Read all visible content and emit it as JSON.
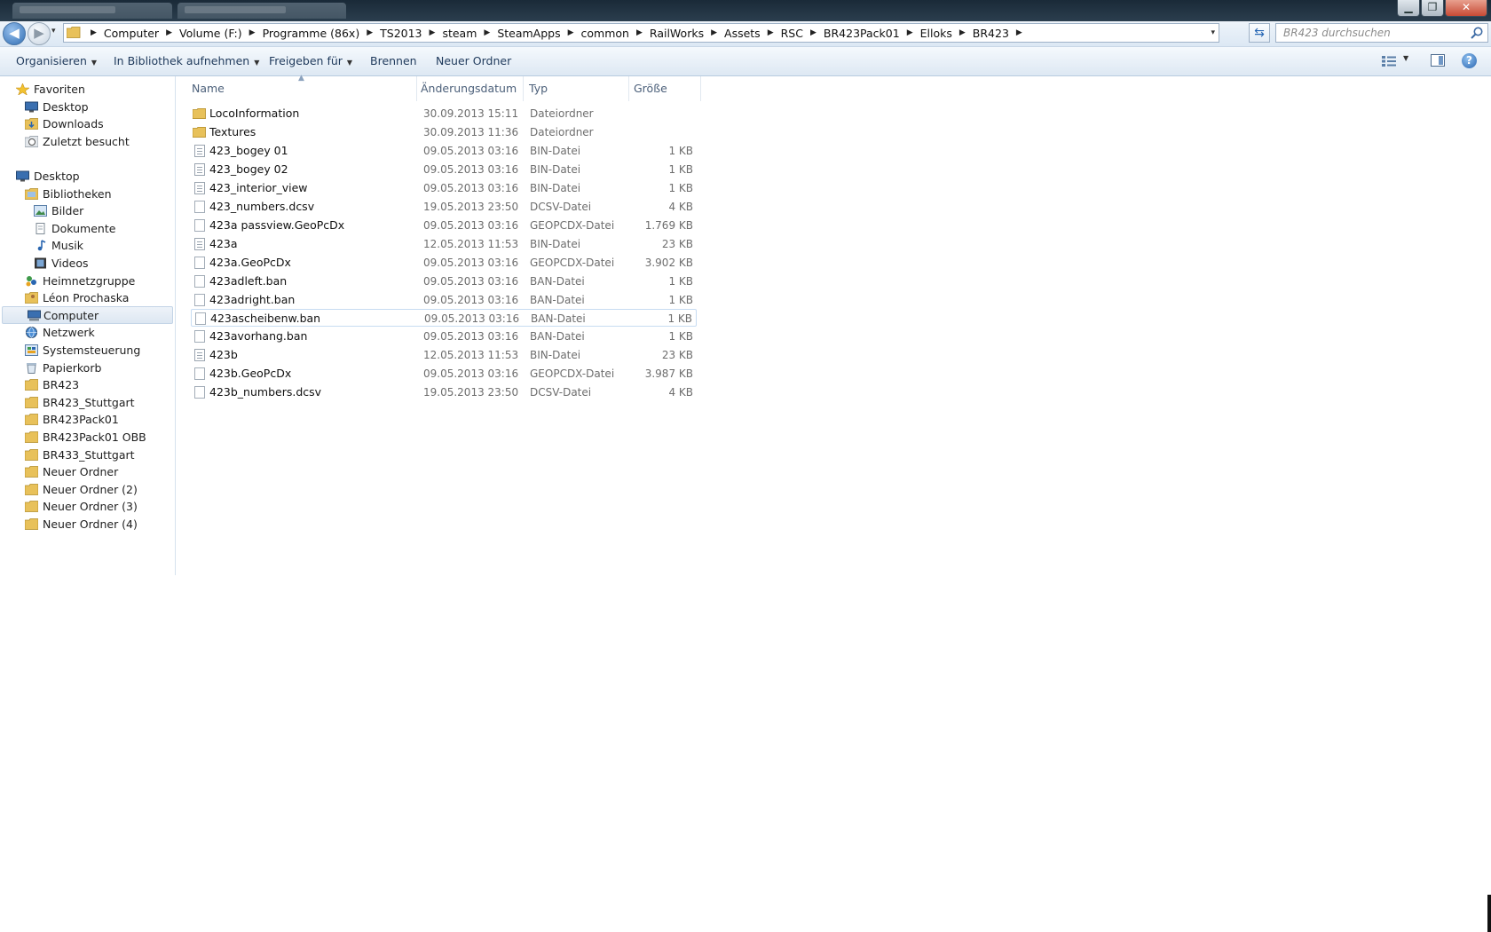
{
  "window": {
    "minimize": "▁",
    "maximize": "❐",
    "close": "✕"
  },
  "navigation": {
    "back": "◀",
    "forward": "▶",
    "dropdown": "▾"
  },
  "address": {
    "breadcrumb": [
      "Computer",
      "Volume (F:)",
      "Programme (86x)",
      "TS2013",
      "steam",
      "SteamApps",
      "common",
      "RailWorks",
      "Assets",
      "RSC",
      "BR423Pack01",
      "Elloks",
      "BR423"
    ],
    "separator": "▶"
  },
  "search": {
    "placeholder": "BR423 durchsuchen"
  },
  "toolbar": {
    "organize": "Organisieren",
    "add_to_library": "In Bibliothek aufnehmen",
    "share_with": "Freigeben für",
    "burn": "Brennen",
    "new_folder": "Neuer Ordner",
    "help": "?"
  },
  "sidebar": {
    "favorites": {
      "label": "Favoriten",
      "items": [
        "Desktop",
        "Downloads",
        "Zuletzt besucht"
      ]
    },
    "desktop": "Desktop",
    "libraries": {
      "label": "Bibliotheken",
      "items": [
        "Bilder",
        "Dokumente",
        "Musik",
        "Videos"
      ]
    },
    "items": [
      "Heimnetzgruppe",
      "Léon Prochaska",
      "Computer",
      "Netzwerk",
      "Systemsteuerung",
      "Papierkorb",
      "BR423",
      "BR423_Stuttgart",
      "BR423Pack01",
      "BR423Pack01 OBB",
      "BR433_Stuttgart",
      "Neuer Ordner",
      "Neuer Ordner (2)",
      "Neuer Ordner (3)",
      "Neuer Ordner (4)"
    ],
    "selected": "Computer"
  },
  "columns": {
    "name": "Name",
    "date": "Änderungsdatum",
    "type": "Typ",
    "size": "Größe"
  },
  "files": [
    {
      "name": "LocoInformation",
      "date": "30.09.2013 15:11",
      "type": "Dateiordner",
      "size": "",
      "icon": "folder"
    },
    {
      "name": "Textures",
      "date": "30.09.2013 11:36",
      "type": "Dateiordner",
      "size": "",
      "icon": "folder"
    },
    {
      "name": "423_bogey 01",
      "date": "09.05.2013 03:16",
      "type": "BIN-Datei",
      "size": "1 KB",
      "icon": "doc"
    },
    {
      "name": "423_bogey 02",
      "date": "09.05.2013 03:16",
      "type": "BIN-Datei",
      "size": "1 KB",
      "icon": "doc"
    },
    {
      "name": "423_interior_view",
      "date": "09.05.2013 03:16",
      "type": "BIN-Datei",
      "size": "1 KB",
      "icon": "doc"
    },
    {
      "name": "423_numbers.dcsv",
      "date": "19.05.2013 23:50",
      "type": "DCSV-Datei",
      "size": "4 KB",
      "icon": "blank"
    },
    {
      "name": "423a passview.GeoPcDx",
      "date": "09.05.2013 03:16",
      "type": "GEOPCDX-Datei",
      "size": "1.769 KB",
      "icon": "blank"
    },
    {
      "name": "423a",
      "date": "12.05.2013 11:53",
      "type": "BIN-Datei",
      "size": "23 KB",
      "icon": "doc"
    },
    {
      "name": "423a.GeoPcDx",
      "date": "09.05.2013 03:16",
      "type": "GEOPCDX-Datei",
      "size": "3.902 KB",
      "icon": "blank"
    },
    {
      "name": "423adleft.ban",
      "date": "09.05.2013 03:16",
      "type": "BAN-Datei",
      "size": "1 KB",
      "icon": "blank"
    },
    {
      "name": "423adright.ban",
      "date": "09.05.2013 03:16",
      "type": "BAN-Datei",
      "size": "1 KB",
      "icon": "blank"
    },
    {
      "name": "423ascheibenw.ban",
      "date": "09.05.2013 03:16",
      "type": "BAN-Datei",
      "size": "1 KB",
      "icon": "blank",
      "highlighted": true
    },
    {
      "name": "423avorhang.ban",
      "date": "09.05.2013 03:16",
      "type": "BAN-Datei",
      "size": "1 KB",
      "icon": "blank"
    },
    {
      "name": "423b",
      "date": "12.05.2013 11:53",
      "type": "BIN-Datei",
      "size": "23 KB",
      "icon": "doc"
    },
    {
      "name": "423b.GeoPcDx",
      "date": "09.05.2013 03:16",
      "type": "GEOPCDX-Datei",
      "size": "3.987 KB",
      "icon": "blank"
    },
    {
      "name": "423b_numbers.dcsv",
      "date": "19.05.2013 23:50",
      "type": "DCSV-Datei",
      "size": "4 KB",
      "icon": "blank"
    }
  ],
  "colors": {
    "accent": "#2f6db3",
    "folder": "#e8c15a",
    "header_text": "#4c607a",
    "selection_border": "#c7dcf2"
  }
}
